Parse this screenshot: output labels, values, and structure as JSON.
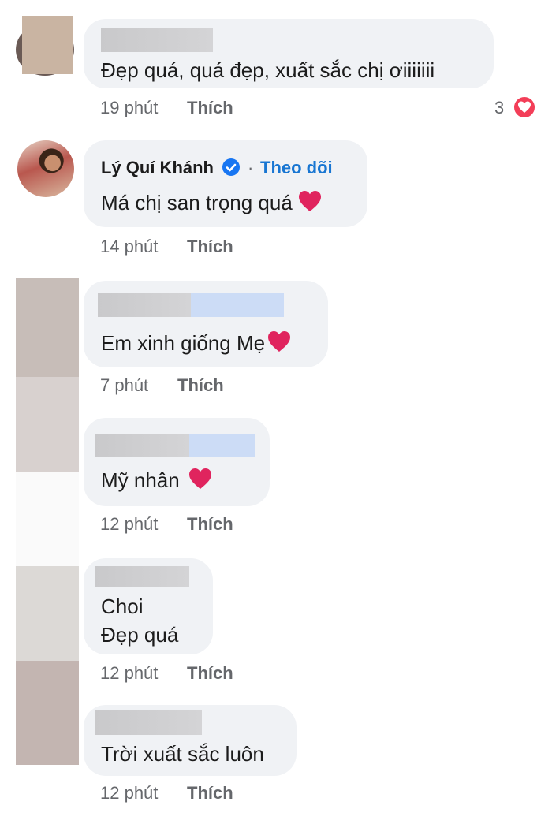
{
  "comments": [
    {
      "text": "Đẹp quá, quá đẹp, xuất sắc chị ơiiiiiii",
      "time": "19 phút",
      "like": "Thích",
      "reaction_count": "3"
    },
    {
      "author": "Lý Quí Khánh",
      "follow": "Theo dõi",
      "separator": "·",
      "text": "Má chị san trọng quá",
      "time": "14 phút",
      "like": "Thích"
    },
    {
      "text": "Em xinh giống Mẹ",
      "time": "7 phút",
      "like": "Thích"
    },
    {
      "text": "Mỹ nhân",
      "time": "12 phút",
      "like": "Thích"
    },
    {
      "text_line1": "Choi",
      "text_line2": "Đẹp quá",
      "time": "12 phút",
      "like": "Thích"
    },
    {
      "text": "Trời xuất sắc luôn",
      "time": "12 phút",
      "like": "Thích"
    }
  ],
  "colors": {
    "bubble": "#f0f2f5",
    "link_blue": "#1876d2",
    "meta_gray": "#65676b",
    "heart_red": "#e0245e"
  },
  "icons": [
    "heart-emoji-icon",
    "verified-badge-icon",
    "love-reaction-icon"
  ]
}
